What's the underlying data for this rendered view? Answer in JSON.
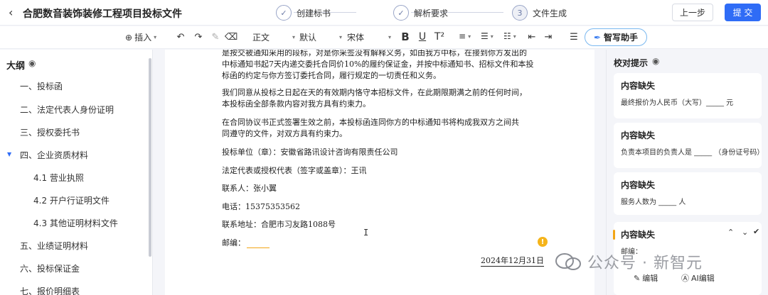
{
  "header": {
    "title": "合肥数音装饰装修工程项目投标文件",
    "steps": [
      {
        "label": "创建标书"
      },
      {
        "label": "解析要求"
      },
      {
        "number": "3",
        "label": "文件生成"
      }
    ],
    "prev_label": "上一步",
    "submit_label": "提 交"
  },
  "toolbar": {
    "insert_label": "插入",
    "style_label": "正文",
    "size_label": "默认",
    "font_label": "宋体",
    "assistant_label": "智写助手"
  },
  "outline": {
    "title": "大纲",
    "items": [
      {
        "label": "一、投标函"
      },
      {
        "label": "二、法定代表人身份证明"
      },
      {
        "label": "三、授权委托书"
      },
      {
        "label": "四、企业资质材料"
      },
      {
        "label": "4.1 营业执照"
      },
      {
        "label": "4.2 开户行证明文件"
      },
      {
        "label": "4.3 其他证明材料文件"
      },
      {
        "label": "五、业绩证明材料"
      },
      {
        "label": "六、投标保证金"
      },
      {
        "label": "七、报价明细表"
      }
    ]
  },
  "document": {
    "para0_line0": "是按交被通知采用的段标，对是你采签没有解释义务，如由我方中标，在接到你方发出的",
    "para0_line1": "中标通知书起7天内递交委托合同价10%的履约保证金，并按中标通知书、招标文件和本投",
    "para0_line2": "标函的约定与你方签订委托合同，履行规定的一切责任和义务。",
    "para1_line0": "我们同意从投标之日起在天的有效期内恪守本招标文件，在此期限期满之前的任何时间，",
    "para1_line1": "本投标函全部条款内容对我方具有约束力。",
    "para2_line0": "在合同协议书正式签署生效之前，本投标函连同你方的中标通知书将构成我双方之间共",
    "para2_line1": "同遵守的文件，对双方具有约束力。",
    "bidder": "投标单位（章）：安徽省路讯设计咨询有限责任公司",
    "legal_rep": "法定代表或授权代表（签字或盖章）：王讯",
    "contact": "联系人：张小翼",
    "phone": "电话：15375353562",
    "address": "联系地址：合肥市习友路1088号",
    "postcode_label": "邮编：",
    "date": "2024年12月31日"
  },
  "proofread": {
    "title": "校对提示",
    "cards": [
      {
        "title": "内容缺失",
        "body": "最终报价为人民币（大写）_____ 元"
      },
      {
        "title": "内容缺失",
        "body": "负责本项目的负责人是 _____ （身份证号码）"
      },
      {
        "title": "内容缺失",
        "body": "服务人数为 _____ 人"
      },
      {
        "title": "内容缺失",
        "body": "邮编：",
        "edit_label": "编辑",
        "ai_edit_label": "AI编辑"
      }
    ]
  },
  "watermark": "公众号 · 新智元",
  "colors": {
    "primary": "#2f6cf6",
    "warning": "#f2a516",
    "assistant_border": "#7ab8f0"
  }
}
